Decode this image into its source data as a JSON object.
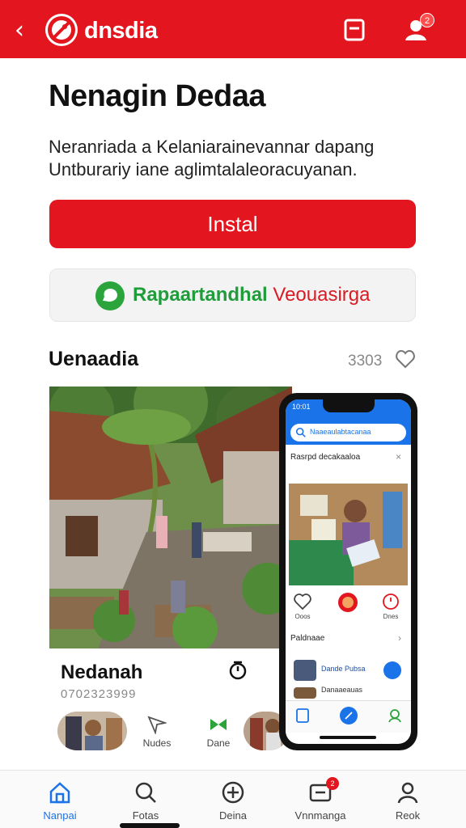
{
  "header": {
    "brand": "dnsdia",
    "back_icon": "chevron-left-icon",
    "logo_icon": "brand-logo-icon",
    "actions": [
      {
        "icon": "note-icon"
      },
      {
        "icon": "account-icon",
        "badge": "2"
      }
    ],
    "color": "#e3151f"
  },
  "app": {
    "title": "Nenagin Dedaa",
    "description": "Neranriada a Kelaniarainevannar dapang Untburariy iane aglimtalaleoracuyanan.",
    "install_label": "Instal",
    "secondary_label_green": "Rapaartandhal",
    "secondary_label_red": "Veouasirga"
  },
  "section": {
    "title": "Uenaadia",
    "count": "3303"
  },
  "card": {
    "name": "Nedanah",
    "code": "0702323999"
  },
  "strip": {
    "items": [
      {
        "label": "Nudes"
      },
      {
        "label": "Dane"
      }
    ]
  },
  "phone": {
    "status_time": "10:01",
    "search_placeholder": "Naaeaulabtacanaa",
    "post_title": "Rasrpd decakaaloa",
    "list_title": "Paldnaae",
    "actions": [
      {
        "label": "Ooos"
      },
      {
        "label": ""
      },
      {
        "label": "Dnes"
      }
    ],
    "items": [
      {
        "label": "Dande Pubsa"
      },
      {
        "label": "Danaaeauas"
      }
    ]
  },
  "bottom_nav": {
    "tabs": [
      {
        "label": "Nanpai",
        "icon": "home-icon",
        "active": true
      },
      {
        "label": "Fotas",
        "icon": "search-icon"
      },
      {
        "label": "Deina",
        "icon": "plus-circle-icon"
      },
      {
        "label": "Vnnmanga",
        "icon": "inbox-icon",
        "badge": "2"
      },
      {
        "label": "Reok",
        "icon": "profile-icon"
      }
    ]
  }
}
